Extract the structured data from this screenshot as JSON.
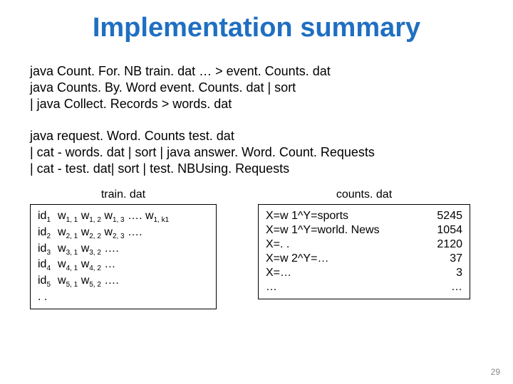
{
  "title": "Implementation summary",
  "pipeline1": {
    "l1": "java Count. For. NB train. dat … > event. Counts. dat",
    "l2": "java Counts. By. Word event. Counts. dat | sort",
    "l3": "| java Collect. Records   > words. dat"
  },
  "pipeline2": {
    "l1": "java request. Word. Counts  test. dat",
    "l2": "| cat - words. dat | sort | java answer. Word. Count. Requests",
    "l3": "| cat - test. dat| sort | test. NBUsing. Requests"
  },
  "train": {
    "caption": "train. dat",
    "rows": {
      "r1_id": "id",
      "r1_sub": "1",
      "r1_body_parts": [
        "w",
        "1, 1",
        " w",
        "1, 2",
        " w",
        "1, 3",
        " …. w",
        "1, k1"
      ],
      "r2_id": "id",
      "r2_sub": "2",
      "r2_body_parts": [
        "w",
        "2, 1",
        " w",
        "2, 2",
        " w",
        "2, 3",
        " …."
      ],
      "r3_id": "id",
      "r3_sub": "3",
      "r3_body_parts": [
        "w",
        "3, 1",
        " w",
        "3, 2",
        " …."
      ],
      "r4_id": "id",
      "r4_sub": "4",
      "r4_body_parts": [
        "w",
        "4, 1",
        " w",
        "4, 2",
        " …"
      ],
      "r5_id": "id",
      "r5_sub": "5",
      "r5_body_parts": [
        "w",
        "5, 1",
        " w",
        "5, 2",
        " …."
      ],
      "dots": ". ."
    }
  },
  "counts": {
    "caption": "counts. dat",
    "left": {
      "l1": "X=w 1^Y=sports",
      "l2": "X=w 1^Y=world. News",
      "l3": "X=. .",
      "l4": "X=w 2^Y=…",
      "l5": "X=…",
      "l6": "…"
    },
    "right": {
      "r1": "5245",
      "r2": "1054",
      "r3": "2120",
      "r4": "37",
      "r5": "3",
      "r6": "…"
    }
  },
  "slide_number": "29"
}
